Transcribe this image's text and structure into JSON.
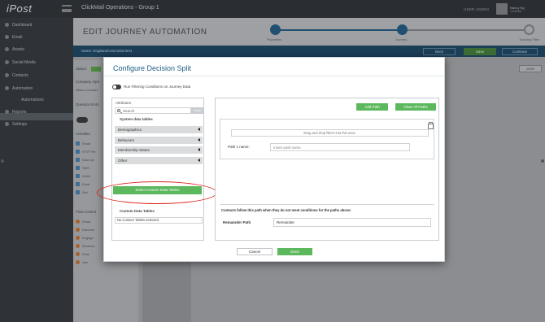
{
  "app": {
    "logo": "iPost",
    "org_title": "ClickMail Operations - Group 1",
    "top_link": "USER ADMIN",
    "user_name": "Nancy Ng",
    "user_sub": "ClickMail"
  },
  "sidebar": {
    "items": [
      {
        "label": "Dashboard"
      },
      {
        "label": "Email"
      },
      {
        "label": "Assets"
      },
      {
        "label": "Social Media"
      },
      {
        "label": "Contacts"
      },
      {
        "label": "Automation"
      },
      {
        "label": "Automations"
      },
      {
        "label": "Reports"
      },
      {
        "label": "Settings"
      }
    ]
  },
  "page": {
    "title": "EDIT JOURNEY AUTOMATION",
    "steps": [
      {
        "label": "Properties"
      },
      {
        "label": "Journey"
      },
      {
        "label": "Tracking Filter"
      }
    ],
    "name_label": "Name:",
    "name_value": "EngilandAutomationtest",
    "back": "Back",
    "save": "Save",
    "continue": "Continue",
    "zoom": "100%"
  },
  "left_panel": {
    "status_label": "Status:",
    "company_label": "Company Opti",
    "company_value": "Allow a contact",
    "question_label": "Question Entri",
    "activities_label": "Activities",
    "activities": [
      {
        "label": "Email"
      },
      {
        "label": "HTTP Re"
      },
      {
        "label": "Data Up"
      },
      {
        "label": "SMS"
      },
      {
        "label": "Webh"
      },
      {
        "label": "Emal"
      },
      {
        "label": "Wel"
      }
    ],
    "flow_label": "Flow Control",
    "flow": [
      {
        "label": "Delay"
      },
      {
        "label": "Random"
      },
      {
        "label": "Engage"
      },
      {
        "label": "Decision"
      },
      {
        "label": "Goal"
      },
      {
        "label": "Join"
      }
    ]
  },
  "modal": {
    "title": "Configure Decision Split",
    "filter_toggle_label": "Run Filtering Conditions on Journey Data",
    "attributes_title": "Attributes",
    "search_placeholder": "Search",
    "clear_label": "Clear",
    "system_tables_heading": "System data tables",
    "categories": [
      {
        "label": "Demographics"
      },
      {
        "label": "Behaviors"
      },
      {
        "label": "Membership Status"
      },
      {
        "label": "Other"
      }
    ],
    "custom_tables_heading": "Custom Data Tables",
    "custom_tables_value": "No Custom Tables selected",
    "select_custom_button": "Select Custom Data Tables",
    "add_path_button": "Add Path",
    "clear_paths_button": "Clear All Paths",
    "drop_zone_text": "Drag and drop filters into this area.",
    "path_name_label": "Path 1 name:",
    "path_name_placeholder": "Insert path name",
    "remainder_note": "Contacts follow this path when they do not meet conditions for the paths above:",
    "remainder_label": "Remainder Path",
    "remainder_value": "Remainder",
    "cancel_button": "Cancel",
    "done_button": "Done"
  },
  "colors": {
    "accent_blue": "#1f5e86",
    "primary_green": "#5cb85c",
    "annotation_red": "#d9241b",
    "nav_dark": "#1c3f58"
  }
}
